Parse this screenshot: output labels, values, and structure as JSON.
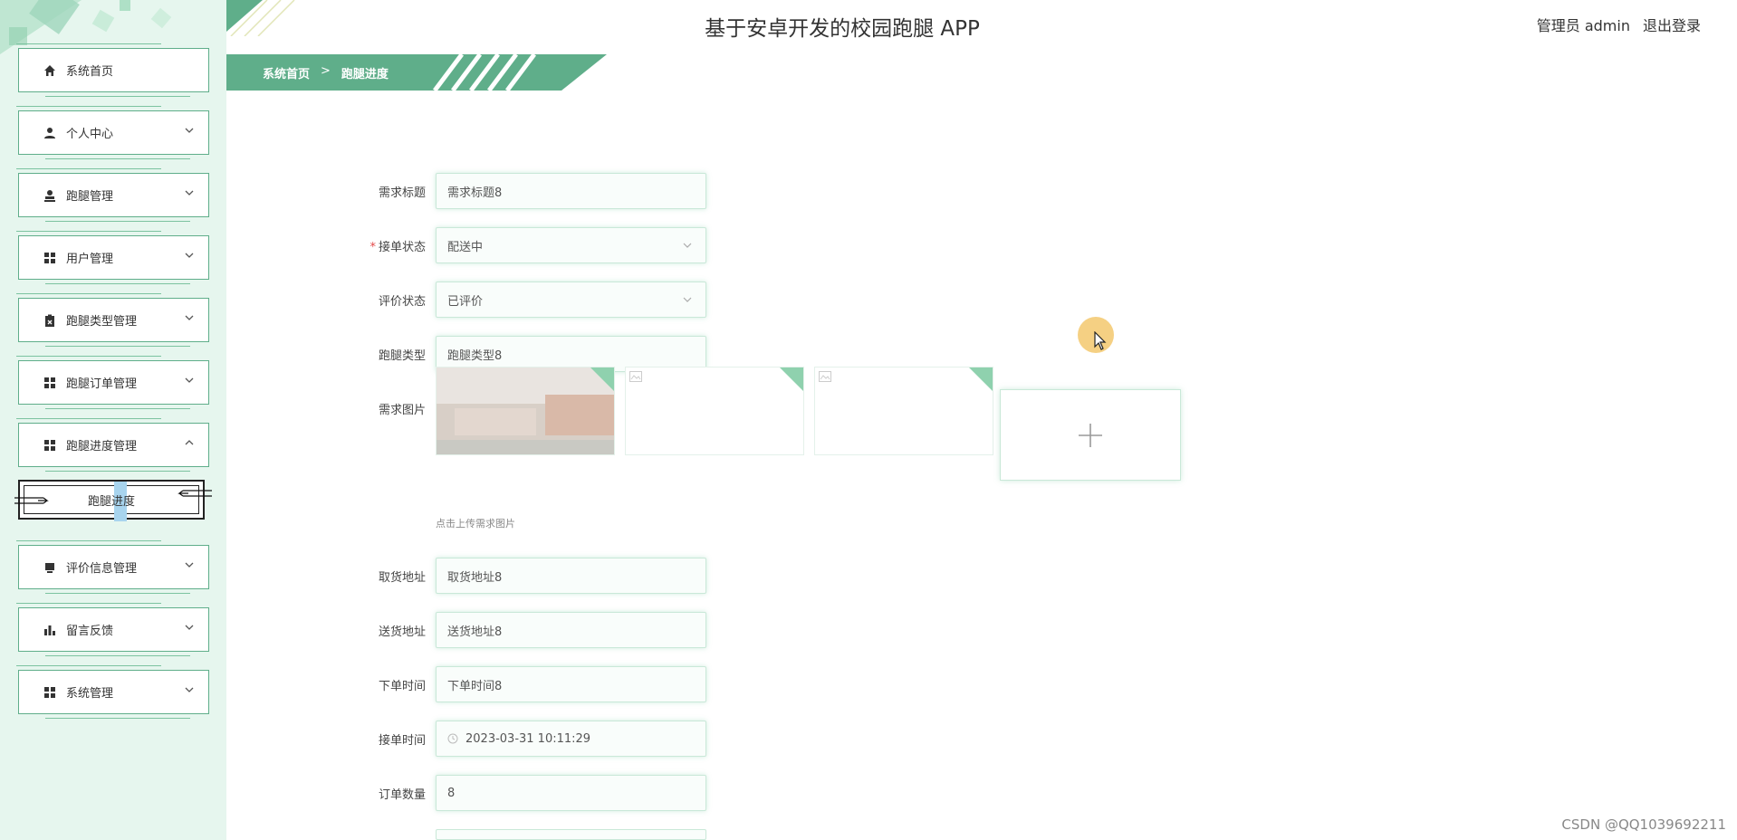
{
  "header": {
    "title": "基于安卓开发的校园跑腿 APP",
    "user_label": "管理员 admin",
    "logout_label": "退出登录"
  },
  "breadcrumb": {
    "home": "系统首页",
    "separator": ">",
    "current": "跑腿进度"
  },
  "sidebar": {
    "items": [
      {
        "label": "系统首页",
        "icon": "home-icon"
      },
      {
        "label": "个人中心",
        "icon": "person-icon"
      },
      {
        "label": "跑腿管理",
        "icon": "user-stamp-icon"
      },
      {
        "label": "用户管理",
        "icon": "grid-icon"
      },
      {
        "label": "跑腿类型管理",
        "icon": "clipboard-icon"
      },
      {
        "label": "跑腿订单管理",
        "icon": "grid-icon"
      },
      {
        "label": "跑腿进度管理",
        "icon": "grid-icon"
      },
      {
        "label": "评价信息管理",
        "icon": "inbox-icon"
      },
      {
        "label": "留言反馈",
        "icon": "bar-chart-icon"
      },
      {
        "label": "系统管理",
        "icon": "grid-icon"
      }
    ],
    "sub_item": {
      "label": "跑腿进度"
    }
  },
  "form": {
    "title_label": "需求标题",
    "title_value": "需求标题8",
    "status_label": "接单状态",
    "status_value": "配送中",
    "eval_label": "评价状态",
    "eval_value": "已评价",
    "type_label": "跑腿类型",
    "type_value": "跑腿类型8",
    "image_label": "需求图片",
    "upload_tip": "点击上传需求图片",
    "pickup_label": "取货地址",
    "pickup_value": "取货地址8",
    "delivery_label": "送货地址",
    "delivery_value": "送货地址8",
    "order_time_label": "下单时间",
    "order_time_value": "下单时间8",
    "accept_time_label": "接单时间",
    "accept_time_value": "2023-03-31 10:11:29",
    "quantity_label": "订单数量",
    "quantity_value": "8",
    "required_mark": "*"
  },
  "watermark": "CSDN @QQ1039692211",
  "colors": {
    "accent": "#5fae8a",
    "sidebar_bg": "#e6f6ee",
    "banner": "#5fae8a"
  }
}
